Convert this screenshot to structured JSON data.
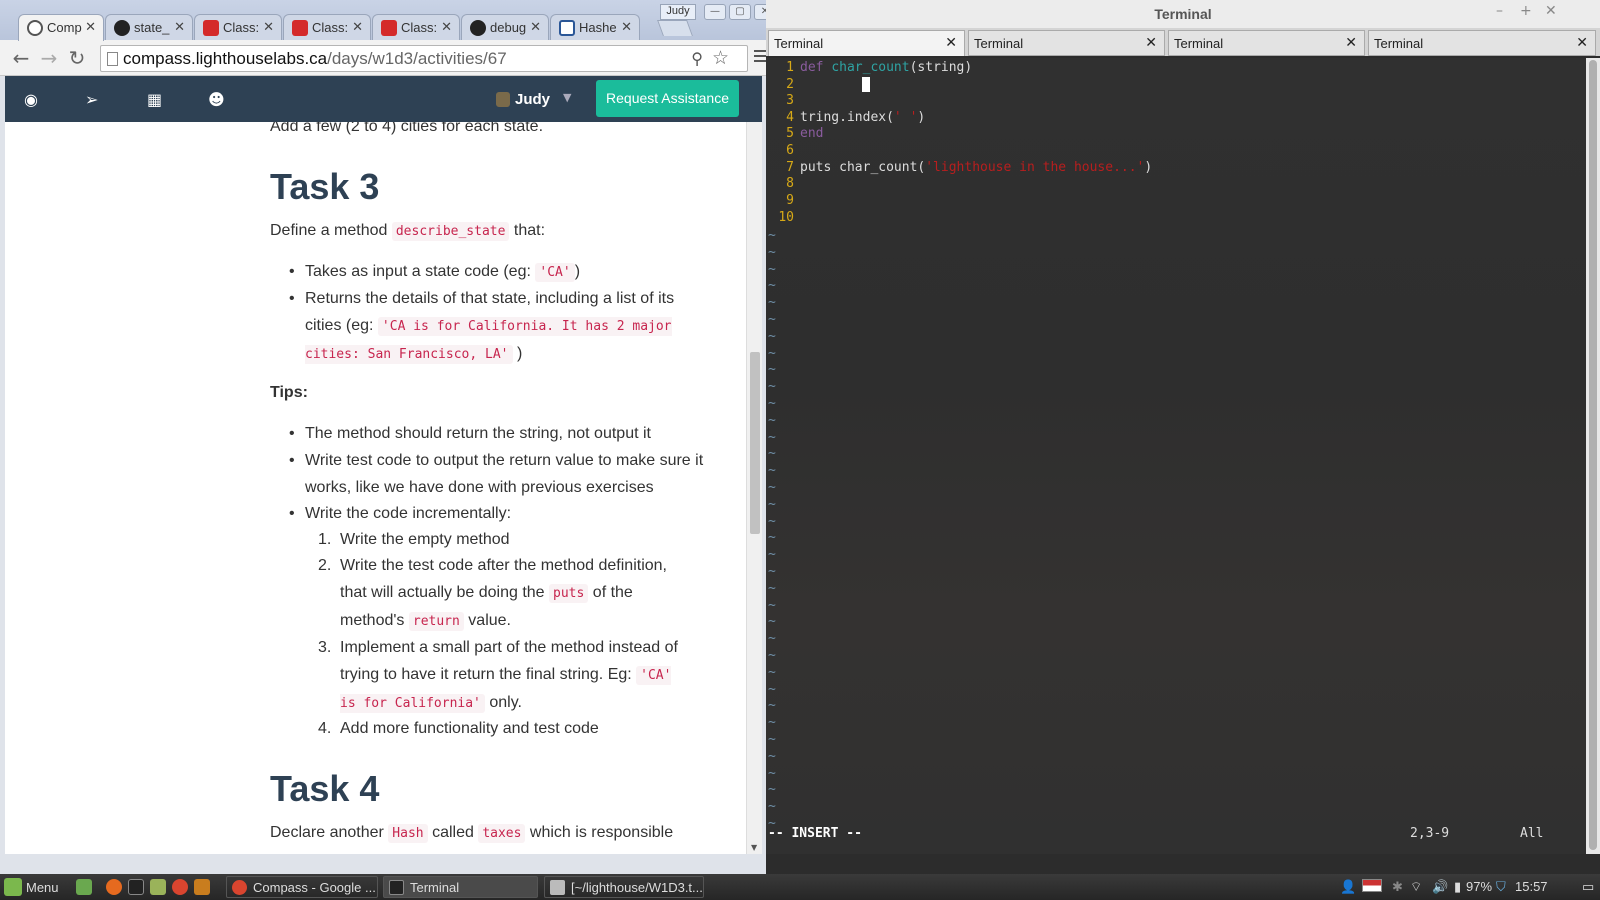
{
  "browser": {
    "tabs": [
      {
        "label": "Comp",
        "icon": "compass-icon",
        "active": true
      },
      {
        "label": "state_",
        "icon": "github-icon"
      },
      {
        "label": "Class:",
        "icon": "thumbs-icon"
      },
      {
        "label": "Class:",
        "icon": "thumbs-icon"
      },
      {
        "label": "Class:",
        "icon": "thumbs-icon"
      },
      {
        "label": "debug",
        "icon": "github-icon"
      },
      {
        "label": "Hashe",
        "icon": "doc-icon"
      }
    ],
    "profile_name": "Judy",
    "url_host": "compass.lighthouselabs.ca",
    "url_path": "/days/w1d3/activities/67"
  },
  "site_nav": {
    "user_name": "Judy",
    "assist_button": "Request Assistance"
  },
  "article": {
    "lead_text": "Add a few (2 to 4) cities for each state.",
    "task3_title": "Task 3",
    "task3_intro_pre": "Define a method",
    "task3_intro_code": "describe_state",
    "task3_intro_post": "that:",
    "b1_pre": "Takes as input a state code (eg:",
    "b1_code": "'CA'",
    "b1_post": ")",
    "b2_pre": "Returns the details of that state, including a list of its cities (eg:",
    "b2_code": "'CA is for California. It has 2 major cities: San Francisco, LA'",
    "b2_post": ")",
    "tips": "Tips:",
    "t1": "The method should return the string, not output it",
    "t2": "Write test code to output the return value to make sure it works, like we have done with previous exercises",
    "t3": "Write the code incrementally:",
    "n1": "Write the empty method",
    "n2_pre": "Write the test code after the method definition, that will actually be doing the",
    "n2_code1": "puts",
    "n2_mid": "of the method's",
    "n2_code2": "return",
    "n2_post": "value.",
    "n3_pre": "Implement a small part of the method instead of trying to have it return the final string. Eg:",
    "n3_code": "'CA' is for California'",
    "n3_post": "only.",
    "n4": "Add more functionality and test code",
    "task4_title": "Task 4",
    "task4_pre": "Declare another",
    "task4_code1": "Hash",
    "task4_mid": "called",
    "task4_code2": "taxes",
    "task4_post": "which is responsible"
  },
  "terminal": {
    "window_title": "Terminal",
    "tabs": [
      "Terminal",
      "Terminal",
      "Terminal",
      "Terminal"
    ],
    "lines": [
      {
        "n": "1",
        "kw": "def ",
        "fn": "char_count",
        "rest": "(string)"
      },
      {
        "n": "2",
        "rest": ""
      },
      {
        "n": "3",
        "rest": ""
      },
      {
        "n": "4",
        "pre": "tring.index(",
        "str": "' '",
        "rest": ")"
      },
      {
        "n": "5",
        "kw": "end"
      },
      {
        "n": "6",
        "rest": ""
      },
      {
        "n": "7",
        "pre": "puts char_count(",
        "str": "'lighthouse in the house...'",
        "rest": ")"
      },
      {
        "n": "8",
        "rest": ""
      },
      {
        "n": "9",
        "rest": ""
      },
      {
        "n": "10",
        "rest": ""
      }
    ],
    "mode": "-- INSERT --",
    "position": "2,3-9",
    "scroll": "All"
  },
  "taskbar": {
    "menu": "Menu",
    "windows": [
      "Compass - Google ...",
      "Terminal",
      "[~/lighthouse/W1D3.t..."
    ],
    "battery": "97%",
    "time": "15:57"
  }
}
